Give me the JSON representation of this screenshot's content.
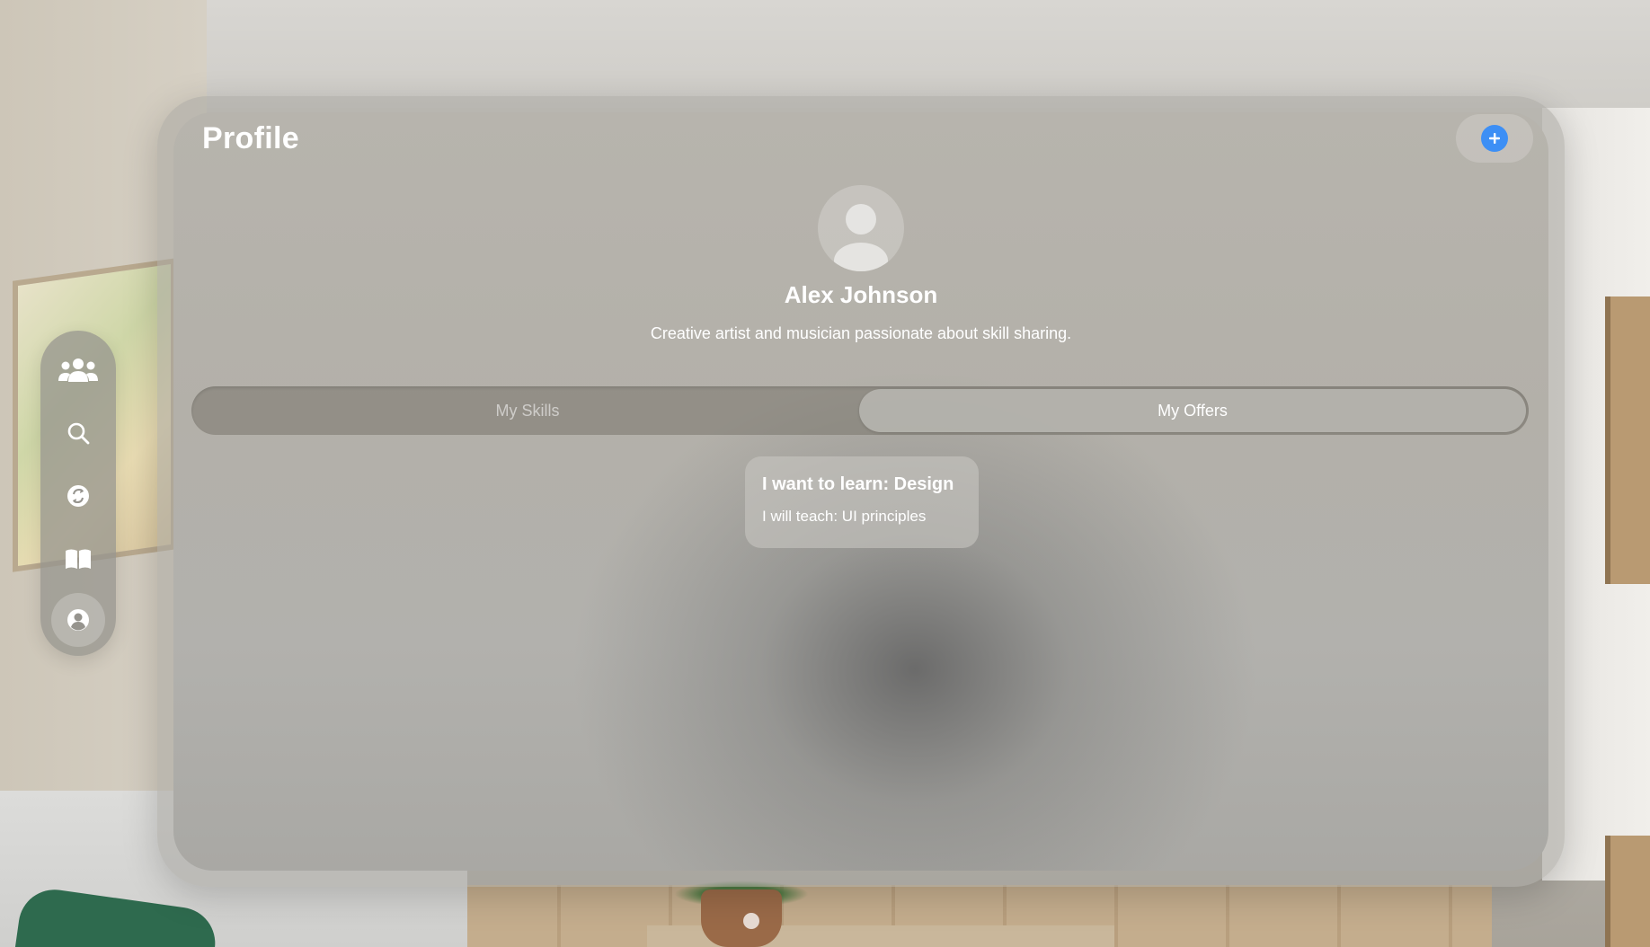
{
  "header": {
    "title": "Profile",
    "add_icon": "plus-circle-icon"
  },
  "profile": {
    "avatar_icon": "person-silhouette-icon",
    "name": "Alex Johnson",
    "bio": "Creative artist and musician passionate about skill sharing."
  },
  "tabs": [
    {
      "label": "My Skills",
      "selected": false
    },
    {
      "label": "My Offers",
      "selected": true
    }
  ],
  "offers": [
    {
      "title": "I want to learn: Design",
      "subtitle": "I will teach: UI principles"
    }
  ],
  "sidebar": {
    "items": [
      {
        "icon": "people-icon",
        "active": false
      },
      {
        "icon": "search-icon",
        "active": false
      },
      {
        "icon": "exchange-icon",
        "active": false
      },
      {
        "icon": "book-icon",
        "active": false
      },
      {
        "icon": "person-circle-icon",
        "active": true
      }
    ]
  },
  "colors": {
    "accent": "#3d8ff5",
    "text": "#ffffff"
  }
}
